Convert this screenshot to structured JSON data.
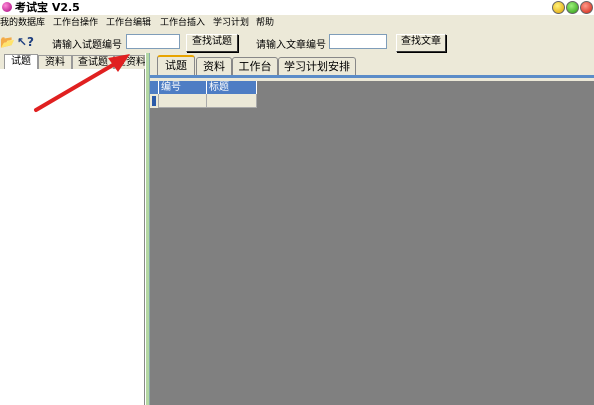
{
  "window": {
    "title": "考试宝 V2.5"
  },
  "menu": {
    "items": [
      "我的数据库",
      "工作台操作",
      "工作台编辑",
      "工作台插入",
      "学习计划",
      "帮助"
    ]
  },
  "toolbar": {
    "question_label": "请输入试题编号",
    "question_value": "",
    "find_question_button": "查找试题",
    "article_label": "请输入文章编号",
    "article_value": "",
    "find_article_button": "查找文章"
  },
  "left_tabs": [
    "试题",
    "资料",
    "查试题",
    "查资料"
  ],
  "right_tabs": [
    "试题",
    "资料",
    "工作台",
    "学习计划安排"
  ],
  "grid": {
    "columns": [
      "编号",
      "标题"
    ]
  },
  "colors": {
    "header_blue": "#4e7dc4",
    "arrow_red": "#e02020",
    "tab_highlight": "#e8a400"
  },
  "icons": [
    "folder-icon",
    "help-pointer-icon"
  ]
}
